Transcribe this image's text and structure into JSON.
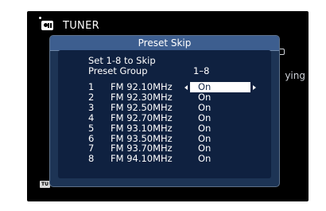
{
  "source": {
    "icon": "tuner-icon",
    "label": "TUNER"
  },
  "background": {
    "side_text": "ying",
    "badge": "TU"
  },
  "dialog": {
    "title": "Preset Skip",
    "set_label": "Set 1-8 to Skip",
    "preset_group_label": "Preset Group",
    "preset_group_value": "1–8",
    "selected_index": 0,
    "presets": [
      {
        "num": "1",
        "freq": "FM 92.10MHz",
        "state": "On"
      },
      {
        "num": "2",
        "freq": "FM 92.30MHz",
        "state": "On"
      },
      {
        "num": "3",
        "freq": "FM 92.50MHz",
        "state": "On"
      },
      {
        "num": "4",
        "freq": "FM 92.70MHz",
        "state": "On"
      },
      {
        "num": "5",
        "freq": "FM 93.10MHz",
        "state": "On"
      },
      {
        "num": "6",
        "freq": "FM 93.50MHz",
        "state": "On"
      },
      {
        "num": "7",
        "freq": "FM 93.70MHz",
        "state": "On"
      },
      {
        "num": "8",
        "freq": "FM 94.10MHz",
        "state": "On"
      }
    ]
  },
  "colors": {
    "dialog_bg": "#1d3455",
    "title_bar": "#3d5e8f",
    "highlight": "#ffffff",
    "highlight_text": "#102447"
  }
}
